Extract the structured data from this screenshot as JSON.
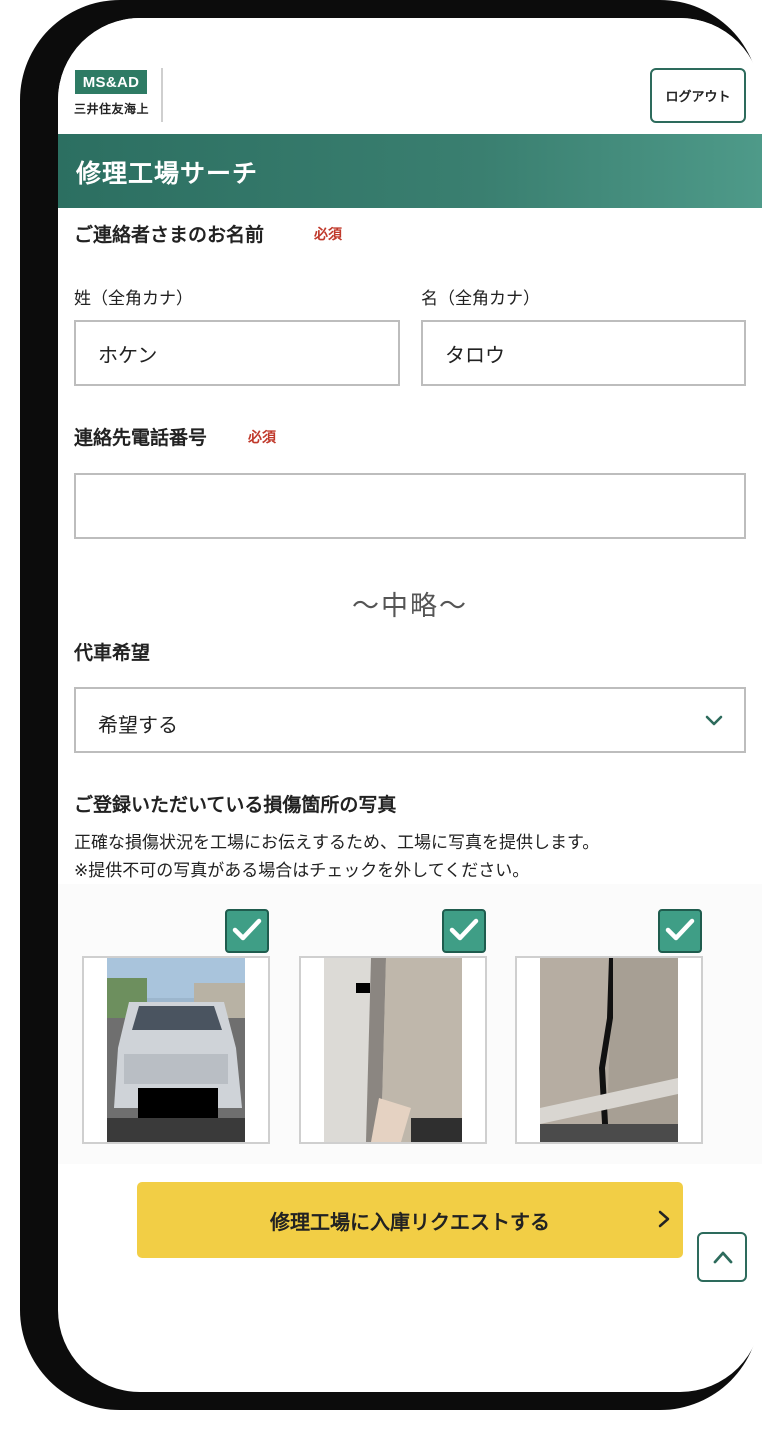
{
  "header": {
    "logo_text": "MS&AD",
    "logo_subtext": "三井住友海上",
    "logout_label": "ログアウト"
  },
  "title": "修理工場サーチ",
  "contact_name": {
    "label": "ご連絡者さまのお名前",
    "required": "必須",
    "last_name_label": "姓（全角カナ）",
    "last_name_value": "ホケン",
    "first_name_label": "名（全角カナ）",
    "first_name_value": "タロウ"
  },
  "phone": {
    "label": "連絡先電話番号",
    "required": "必須",
    "value": ""
  },
  "omitted": "〜中略〜",
  "rental_car": {
    "label": "代車希望",
    "selected": "希望する"
  },
  "photos": {
    "title": "ご登録いただいている損傷箇所の写真",
    "description": "正確な損傷状況を工場にお伝えするため、工場に写真を提供します。",
    "note": "※提供不可の写真がある場合はチェックを外してください。",
    "items": [
      {
        "checked": true,
        "icon": "car-front-photo"
      },
      {
        "checked": true,
        "icon": "car-door-edge-photo"
      },
      {
        "checked": true,
        "icon": "car-door-panel-photo"
      }
    ]
  },
  "submit_label": "修理工場に入庫リクエストする",
  "colors": {
    "brand_green": "#2e7b64",
    "cta_yellow": "#f2ce45",
    "required_red": "#c0392b"
  }
}
